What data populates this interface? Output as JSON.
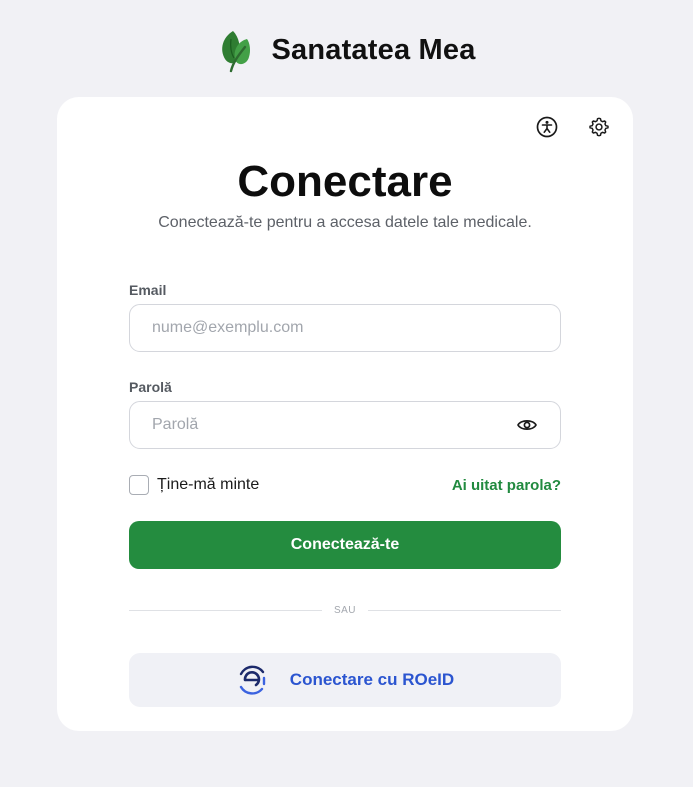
{
  "brand": {
    "name": "Sanatatea Mea",
    "logo_icon": "leaf-logo-icon"
  },
  "header_icons": {
    "accessibility_icon": "accessibility-icon",
    "settings_icon": "gear-icon"
  },
  "form": {
    "title": "Conectare",
    "subtitle": "Conectează-te pentru a accesa datele tale medicale.",
    "email_label": "Email",
    "email_placeholder": "nume@exemplu.com",
    "email_value": "",
    "password_label": "Parolă",
    "password_placeholder": "Parolă",
    "password_value": "",
    "remember_label": "Ține-mă minte",
    "remember_checked": false,
    "forgot_link": "Ai uitat parola?",
    "submit_label": "Conectează-te",
    "divider_text": "SAU",
    "roeid_label": "Conectare cu ROeID"
  },
  "colors": {
    "background": "#f1f1f5",
    "card": "#ffffff",
    "primary_green": "#248c3f",
    "link_green": "#218a3f",
    "roeid_blue": "#2b55d0",
    "roeid_bg": "#f0f1f6"
  }
}
